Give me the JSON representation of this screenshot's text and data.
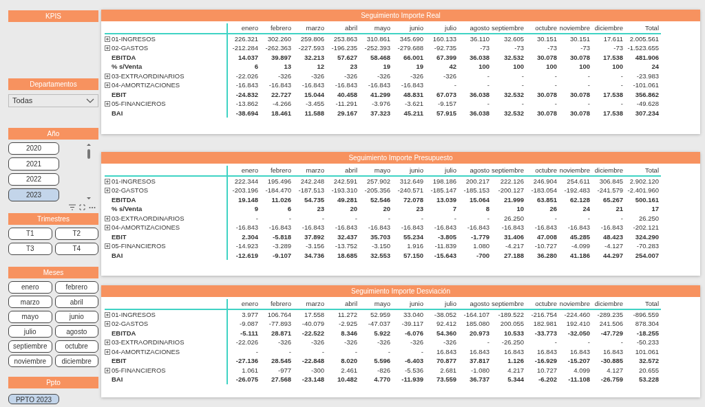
{
  "sidebar": {
    "kpis": {
      "title": "KPIS"
    },
    "departamentos": {
      "title": "Departamentos",
      "dropdown_value": "Todas"
    },
    "anio": {
      "title": "Año",
      "items": [
        {
          "label": "2020",
          "selected": false
        },
        {
          "label": "2021",
          "selected": false
        },
        {
          "label": "2022",
          "selected": false
        },
        {
          "label": "2023",
          "selected": true
        }
      ]
    },
    "trimestres": {
      "title": "Trimestres",
      "items": [
        {
          "label": "T1",
          "selected": false
        },
        {
          "label": "T2",
          "selected": false
        },
        {
          "label": "T3",
          "selected": false
        },
        {
          "label": "T4",
          "selected": false
        }
      ]
    },
    "meses": {
      "title": "Meses",
      "items": [
        {
          "label": "enero",
          "selected": false
        },
        {
          "label": "febrero",
          "selected": false
        },
        {
          "label": "marzo",
          "selected": false
        },
        {
          "label": "abril",
          "selected": false
        },
        {
          "label": "mayo",
          "selected": false
        },
        {
          "label": "junio",
          "selected": false
        },
        {
          "label": "julio",
          "selected": false
        },
        {
          "label": "agosto",
          "selected": false
        },
        {
          "label": "septiembre",
          "selected": false
        },
        {
          "label": "octubre",
          "selected": false
        },
        {
          "label": "noviembre",
          "selected": false
        },
        {
          "label": "diciembre",
          "selected": false
        }
      ]
    },
    "ppto": {
      "title": "Ppto",
      "items": [
        {
          "label": "PPTO 2023",
          "selected": true
        }
      ]
    }
  },
  "tables": [
    {
      "title": "Seguimiento Importe Real",
      "columns": [
        "enero",
        "febrero",
        "marzo",
        "abril",
        "mayo",
        "junio",
        "julio",
        "agosto",
        "septiembre",
        "octubre",
        "noviembre",
        "diciembre",
        "Total"
      ],
      "rows": [
        {
          "label": "01-INGRESOS",
          "kind": "group",
          "values": [
            "226.321",
            "302.260",
            "259.806",
            "253.863",
            "310.861",
            "345.690",
            "160.133",
            "36.110",
            "32.605",
            "30.151",
            "30.151",
            "17.611",
            "2.005.561"
          ]
        },
        {
          "label": "02-GASTOS",
          "kind": "group",
          "values": [
            "-212.284",
            "-262.363",
            "-227.593",
            "-196.235",
            "-252.393",
            "-279.688",
            "-92.735",
            "-73",
            "-73",
            "-73",
            "-73",
            "-73",
            "-1.523.655"
          ]
        },
        {
          "label": "EBITDA",
          "kind": "total",
          "values": [
            "14.037",
            "39.897",
            "32.213",
            "57.627",
            "58.468",
            "66.001",
            "67.399",
            "36.038",
            "32.532",
            "30.078",
            "30.078",
            "17.538",
            "481.906"
          ]
        },
        {
          "label": "% s/Venta",
          "kind": "total",
          "values": [
            "6",
            "13",
            "12",
            "23",
            "19",
            "19",
            "42",
            "100",
            "100",
            "100",
            "100",
            "100",
            "24"
          ]
        },
        {
          "label": "03-EXTRAORDINARIOS",
          "kind": "group",
          "values": [
            "-22.026",
            "-326",
            "-326",
            "-326",
            "-326",
            "-326",
            "-326",
            "-",
            "-",
            "-",
            "-",
            "-",
            "-23.983"
          ]
        },
        {
          "label": "04-AMORTIZACIONES",
          "kind": "group",
          "values": [
            "-16.843",
            "-16.843",
            "-16.843",
            "-16.843",
            "-16.843",
            "-16.843",
            "-",
            "-",
            "-",
            "-",
            "-",
            "-",
            "-101.061"
          ]
        },
        {
          "label": "EBIT",
          "kind": "total",
          "values": [
            "-24.832",
            "22.727",
            "15.044",
            "40.458",
            "41.299",
            "48.831",
            "67.073",
            "36.038",
            "32.532",
            "30.078",
            "30.078",
            "17.538",
            "356.862"
          ]
        },
        {
          "label": "05-FINANCIEROS",
          "kind": "group",
          "values": [
            "-13.862",
            "-4.266",
            "-3.455",
            "-11.291",
            "-3.976",
            "-3.621",
            "-9.157",
            "-",
            "-",
            "-",
            "-",
            "-",
            "-49.628"
          ]
        },
        {
          "label": "BAI",
          "kind": "total",
          "values": [
            "-38.694",
            "18.461",
            "11.588",
            "29.167",
            "37.323",
            "45.211",
            "57.915",
            "36.038",
            "32.532",
            "30.078",
            "30.078",
            "17.538",
            "307.234"
          ]
        }
      ]
    },
    {
      "title": "Seguimiento Importe Presupuesto",
      "columns": [
        "enero",
        "febrero",
        "marzo",
        "abril",
        "mayo",
        "junio",
        "julio",
        "agosto",
        "septiembre",
        "octubre",
        "noviembre",
        "diciembre",
        "Total"
      ],
      "rows": [
        {
          "label": "01-INGRESOS",
          "kind": "group",
          "values": [
            "222.344",
            "195.496",
            "242.248",
            "242.591",
            "257.902",
            "312.649",
            "198.186",
            "200.217",
            "222.126",
            "246.904",
            "254.611",
            "306.845",
            "2.902.120"
          ]
        },
        {
          "label": "02-GASTOS",
          "kind": "group",
          "values": [
            "-203.196",
            "-184.470",
            "-187.513",
            "-193.310",
            "-205.356",
            "-240.571",
            "-185.147",
            "-185.153",
            "-200.127",
            "-183.054",
            "-192.483",
            "-241.579",
            "-2.401.960"
          ]
        },
        {
          "label": "EBITDA",
          "kind": "total",
          "values": [
            "19.148",
            "11.026",
            "54.735",
            "49.281",
            "52.546",
            "72.078",
            "13.039",
            "15.064",
            "21.999",
            "63.851",
            "62.128",
            "65.267",
            "500.161"
          ]
        },
        {
          "label": "% s/Venta",
          "kind": "total",
          "values": [
            "9",
            "6",
            "23",
            "20",
            "20",
            "23",
            "7",
            "8",
            "10",
            "26",
            "24",
            "21",
            "17"
          ]
        },
        {
          "label": "03-EXTRAORDINARIOS",
          "kind": "group",
          "values": [
            "-",
            "-",
            "-",
            "-",
            "-",
            "-",
            "-",
            "-",
            "26.250",
            "-",
            "-",
            "-",
            "26.250"
          ]
        },
        {
          "label": "04-AMORTIZACIONES",
          "kind": "group",
          "values": [
            "-16.843",
            "-16.843",
            "-16.843",
            "-16.843",
            "-16.843",
            "-16.843",
            "-16.843",
            "-16.843",
            "-16.843",
            "-16.843",
            "-16.843",
            "-16.843",
            "-202.121"
          ]
        },
        {
          "label": "EBIT",
          "kind": "total",
          "values": [
            "2.304",
            "-5.818",
            "37.892",
            "32.437",
            "35.703",
            "55.234",
            "-3.805",
            "-1.779",
            "31.406",
            "47.008",
            "45.285",
            "48.423",
            "324.290"
          ]
        },
        {
          "label": "05-FINANCIEROS",
          "kind": "group",
          "values": [
            "-14.923",
            "-3.289",
            "-3.156",
            "-13.752",
            "-3.150",
            "1.916",
            "-11.839",
            "1.080",
            "-4.217",
            "-10.727",
            "-4.099",
            "-4.127",
            "-70.283"
          ]
        },
        {
          "label": "BAI",
          "kind": "total",
          "values": [
            "-12.619",
            "-9.107",
            "34.736",
            "18.685",
            "32.553",
            "57.150",
            "-15.643",
            "-700",
            "27.188",
            "36.280",
            "41.186",
            "44.297",
            "254.007"
          ]
        }
      ]
    },
    {
      "title": "Seguimiento Importe Desviación",
      "columns": [
        "enero",
        "febrero",
        "marzo",
        "abril",
        "mayo",
        "junio",
        "julio",
        "agosto",
        "septiembre",
        "octubre",
        "noviembre",
        "diciembre",
        "Total"
      ],
      "rows": [
        {
          "label": "01-INGRESOS",
          "kind": "group",
          "values": [
            "3.977",
            "106.764",
            "17.558",
            "11.272",
            "52.959",
            "33.040",
            "-38.052",
            "-164.107",
            "-189.522",
            "-216.754",
            "-224.460",
            "-289.235",
            "-896.559"
          ]
        },
        {
          "label": "02-GASTOS",
          "kind": "group",
          "values": [
            "-9.087",
            "-77.893",
            "-40.079",
            "-2.925",
            "-47.037",
            "-39.117",
            "92.412",
            "185.080",
            "200.055",
            "182.981",
            "192.410",
            "241.506",
            "878.304"
          ]
        },
        {
          "label": "EBITDA",
          "kind": "total",
          "values": [
            "-5.111",
            "28.871",
            "-22.522",
            "8.346",
            "5.922",
            "-6.076",
            "54.360",
            "20.973",
            "10.533",
            "-33.773",
            "-32.050",
            "-47.729",
            "-18.255"
          ]
        },
        {
          "label": "03-EXTRAORDINARIOS",
          "kind": "group",
          "values": [
            "-22.026",
            "-326",
            "-326",
            "-326",
            "-326",
            "-326",
            "-326",
            "-",
            "-26.250",
            "-",
            "-",
            "-",
            "-50.233"
          ]
        },
        {
          "label": "04-AMORTIZACIONES",
          "kind": "group",
          "values": [
            "-",
            "-",
            "-",
            "-",
            "-",
            "-",
            "16.843",
            "16.843",
            "16.843",
            "16.843",
            "16.843",
            "16.843",
            "101.061"
          ]
        },
        {
          "label": "EBIT",
          "kind": "total",
          "values": [
            "-27.136",
            "28.545",
            "-22.848",
            "8.020",
            "5.596",
            "-6.403",
            "70.877",
            "37.817",
            "1.126",
            "-16.929",
            "-15.207",
            "-30.885",
            "32.572"
          ]
        },
        {
          "label": "05-FINANCIEROS",
          "kind": "group",
          "values": [
            "1.061",
            "-977",
            "-300",
            "2.461",
            "-826",
            "-5.536",
            "2.681",
            "-1.080",
            "4.217",
            "10.727",
            "4.099",
            "4.127",
            "20.655"
          ]
        },
        {
          "label": "BAI",
          "kind": "total",
          "values": [
            "-26.075",
            "27.568",
            "-23.148",
            "10.482",
            "4.770",
            "-11.939",
            "73.559",
            "36.737",
            "5.344",
            "-6.202",
            "-11.108",
            "-26.759",
            "53.228"
          ]
        }
      ]
    }
  ]
}
